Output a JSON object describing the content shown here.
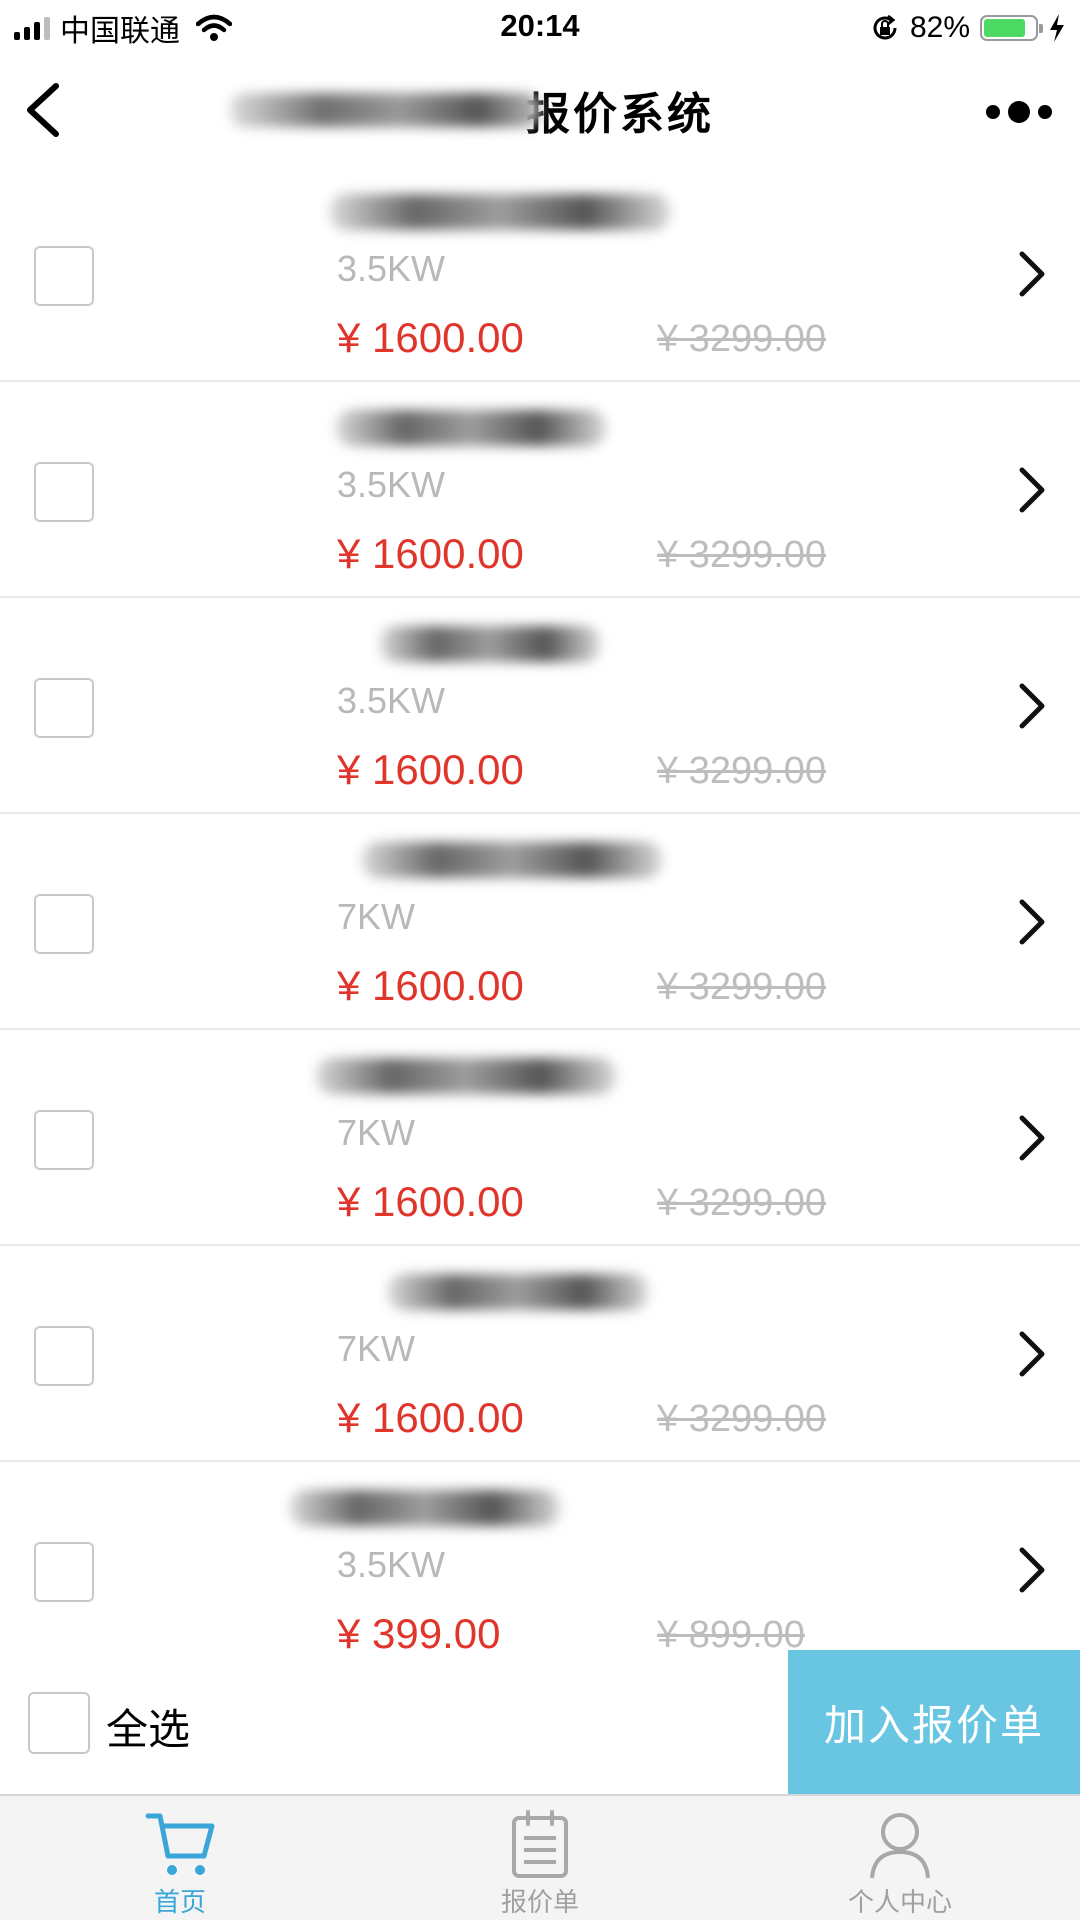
{
  "status_bar": {
    "carrier": "中国联通",
    "time": "20:14",
    "battery_percent": "82%",
    "battery_level": 0.82,
    "icons": [
      "signal-icon",
      "wifi-icon",
      "orientation-lock-icon",
      "battery-icon",
      "charging-bolt-icon"
    ]
  },
  "nav": {
    "title_visible": "报价系统",
    "back_icon": "chevron-left-icon",
    "more_icon": "more-dots-icon"
  },
  "products": [
    {
      "power": "3.5KW",
      "price": "¥ 1600.00",
      "original_price": "¥ 3299.00"
    },
    {
      "power": "3.5KW",
      "price": "¥ 1600.00",
      "original_price": "¥ 3299.00"
    },
    {
      "power": "3.5KW",
      "price": "¥ 1600.00",
      "original_price": "¥ 3299.00"
    },
    {
      "power": "7KW",
      "price": "¥ 1600.00",
      "original_price": "¥ 3299.00"
    },
    {
      "power": "7KW",
      "price": "¥ 1600.00",
      "original_price": "¥ 3299.00"
    },
    {
      "power": "7KW",
      "price": "¥ 1600.00",
      "original_price": "¥ 3299.00"
    },
    {
      "power": "3.5KW",
      "price": "¥ 399.00",
      "original_price": "¥ 899.00"
    }
  ],
  "action_bar": {
    "select_all_label": "全选",
    "add_button_label": "加入报价单"
  },
  "tabs": [
    {
      "label": "首页",
      "icon": "cart-icon",
      "active": true
    },
    {
      "label": "报价单",
      "icon": "clipboard-icon",
      "active": false
    },
    {
      "label": "个人中心",
      "icon": "person-icon",
      "active": false
    }
  ],
  "colors": {
    "price_red": "#e0352b",
    "accent_blue": "#69c6e2",
    "tab_active": "#3aa6d8",
    "muted_gray": "#b8b8b8"
  }
}
